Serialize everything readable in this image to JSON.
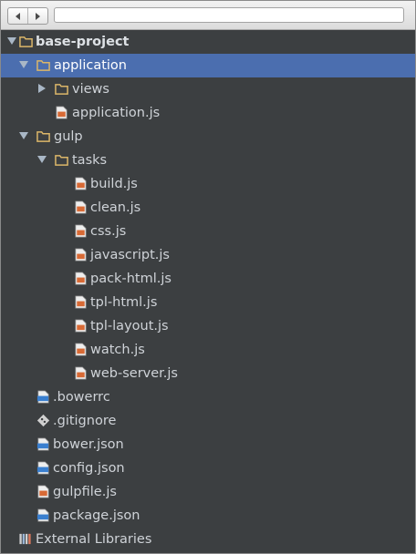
{
  "address": {
    "value": ""
  },
  "tree": {
    "root": "base-project",
    "application": "application",
    "views": "views",
    "application_js": "application.js",
    "gulp": "gulp",
    "tasks": "tasks",
    "task_files": [
      "build.js",
      "clean.js",
      "css.js",
      "javascript.js",
      "pack-html.js",
      "tpl-html.js",
      "tpl-layout.js",
      "watch.js",
      "web-server.js"
    ],
    "root_files": [
      ".bowerrc",
      ".gitignore",
      "bower.json",
      "config.json",
      "gulpfile.js",
      "package.json"
    ],
    "external": "External Libraries"
  },
  "colors": {
    "selection": "#4b6eaf",
    "background": "#3c3f41",
    "folder": "#dbb669",
    "js_badge": "#d86a35",
    "json_badge": "#3a7fcf"
  }
}
